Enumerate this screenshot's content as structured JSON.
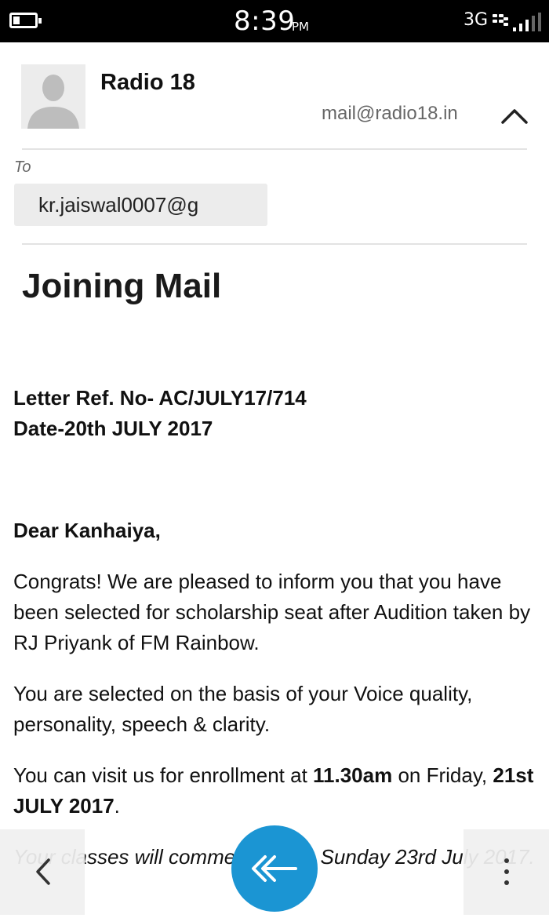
{
  "status_bar": {
    "time": "8:39",
    "ampm": "PM",
    "network": "3G"
  },
  "header": {
    "sender_name": "Radio 18",
    "sender_email": "mail@radio18.in",
    "to_label": "To",
    "recipient": "kr.jaiswal0007@g"
  },
  "subject": "Joining Mail",
  "body": {
    "ref_line": "Letter Ref. No- AC/JULY17/714",
    "date_line": "Date-20th JULY 2017",
    "greeting": "Dear Kanhaiya,",
    "para1": "Congrats!  We are pleased to inform you that you have been selected for scholarship seat after Audition taken by RJ Priyank of FM Rainbow.",
    "para2": "You are selected on the basis of your Voice quality, personality, speech & clarity.",
    "para3_prefix": "You can visit us for enrollment at ",
    "para3_time": "11.30am",
    "para3_mid": " on Friday, ",
    "para3_date": "21st JULY 2017",
    "para3_suffix": ".",
    "para4": "Your classes will commence from Sunday 23rd July 2017."
  },
  "colors": {
    "accent": "#1b95d3",
    "status_bar": "#000000"
  },
  "icons": {
    "back": "chevron-left-icon",
    "reply": "reply-all-icon",
    "more": "more-vertical-icon",
    "collapse": "chevron-up-icon"
  }
}
